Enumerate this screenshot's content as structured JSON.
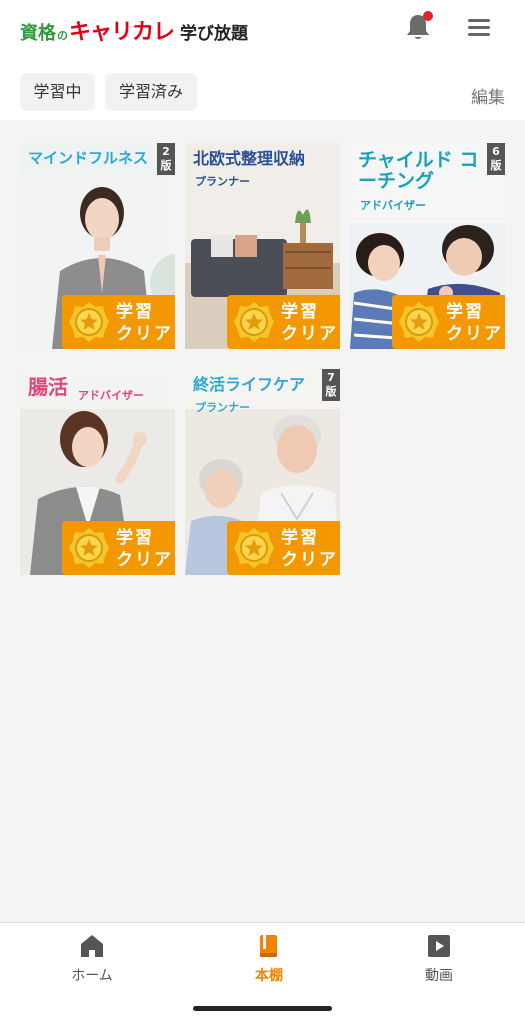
{
  "header": {
    "logo_shikaku": "資格",
    "logo_no": "の",
    "logo_main": "キャリカレ",
    "logo_sub": "学び放題"
  },
  "tabs": [
    {
      "label": "学習中"
    },
    {
      "label": "学習済み"
    }
  ],
  "edit_label": "編集",
  "cards": [
    {
      "title": "マインドフルネス",
      "subtitle": "",
      "edition": "2\n版",
      "badge_line1": "学習",
      "badge_line2": "クリア",
      "title_color": "#2aa8d8"
    },
    {
      "title": "北欧式整理収納",
      "subtitle": "プランナー",
      "edition": "",
      "badge_line1": "学習",
      "badge_line2": "クリア",
      "title_color": "#2a4f9a"
    },
    {
      "title": "チャイルド コーチング",
      "subtitle": "アドバイザー",
      "edition": "6\n版",
      "badge_line1": "学習",
      "badge_line2": "クリア",
      "title_color": "#14a3b8"
    },
    {
      "title": "腸活",
      "subtitle": "アドバイザー",
      "edition": "",
      "badge_line1": "学習",
      "badge_line2": "クリア",
      "title_color": "#e0457b"
    },
    {
      "title": "終活ライフケア",
      "subtitle": "プランナー",
      "edition": "7\n版",
      "badge_line1": "学習",
      "badge_line2": "クリア",
      "title_color": "#2aa8d8"
    }
  ],
  "bottom_nav": [
    {
      "label": "ホーム",
      "icon": "home-icon"
    },
    {
      "label": "本棚",
      "icon": "bookshelf-icon"
    },
    {
      "label": "動画",
      "icon": "video-icon"
    }
  ],
  "colors": {
    "accent": "#f08300",
    "badge": "#f39800",
    "notification_dot": "#e0202a"
  }
}
